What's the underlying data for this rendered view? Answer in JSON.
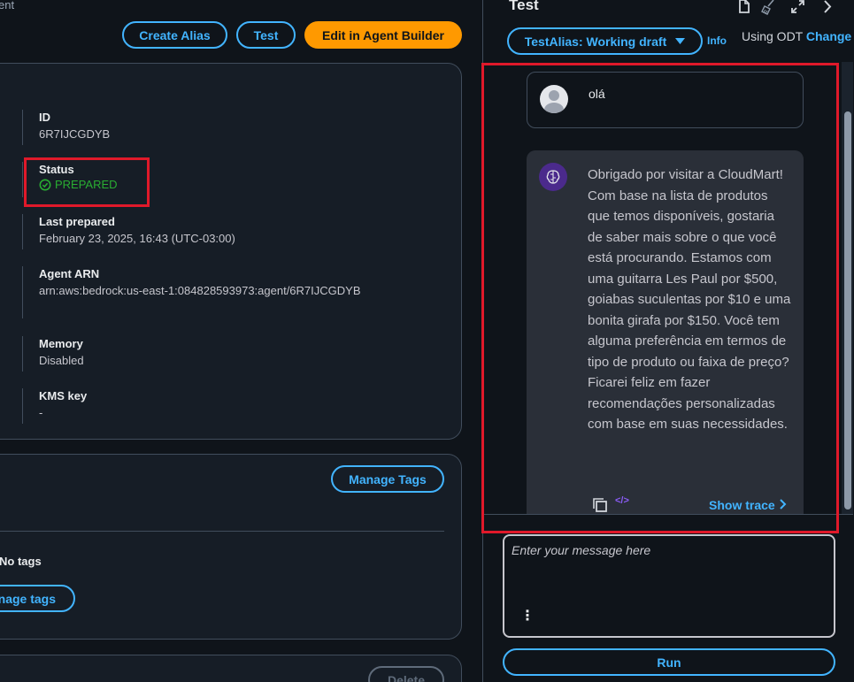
{
  "header": {
    "crumb_fragment": "ent",
    "create_alias_label": "Create Alias",
    "test_label": "Test",
    "edit_label": "Edit in Agent Builder"
  },
  "overview": {
    "id_label": "ID",
    "id_value": "6R7IJCGDYB",
    "status_label": "Status",
    "status_value": "PREPARED",
    "last_prepared_label": "Last prepared",
    "last_prepared_value": "February 23, 2025, 16:43 (UTC-03:00)",
    "arn_label": "Agent ARN",
    "arn_value": "arn:aws:bedrock:us-east-1:084828593973:agent/6R7IJCGDYB",
    "memory_label": "Memory",
    "memory_value": "Disabled",
    "kms_label": "KMS key",
    "kms_value": "-"
  },
  "tags": {
    "manage_tags_label": "Manage Tags",
    "no_tags_label": "No tags",
    "manage_tags_link": "anage tags"
  },
  "bottom": {
    "delete_label": "Delete"
  },
  "test_panel": {
    "title": "Test",
    "alias_label": "TestAlias: Working draft",
    "info_label": "Info",
    "odt_label": "Using ODT",
    "change_label": "Change",
    "user_message": "olá",
    "bot_message": "Obrigado por visitar a CloudMart! Com base na lista de produtos que temos disponíveis, gostaria de saber mais sobre o que você está procurando. Estamos com uma guitarra Les Paul por $500, goiabas suculentas por $10 e uma bonita girafa por $150. Você tem alguma preferência em termos de tipo de produto ou faixa de preço? Ficarei feliz em fazer recomendações personalizadas com base em suas necessidades.",
    "show_trace_label": "Show trace",
    "input_placeholder": "Enter your message here",
    "run_label": "Run"
  },
  "icons": {
    "status": "check-circle-icon",
    "caret": "caret-down-icon",
    "trace": "chevron-right-icon",
    "document": "document-icon",
    "clear": "broom-icon",
    "expand": "expand-icon",
    "collapse": "chevron-right-icon"
  },
  "colors": {
    "accent": "#42b4ff",
    "primary_button": "#ff9900",
    "success": "#29ad32",
    "highlight": "#e0192a",
    "bot_avatar": "#4b2a8c"
  }
}
